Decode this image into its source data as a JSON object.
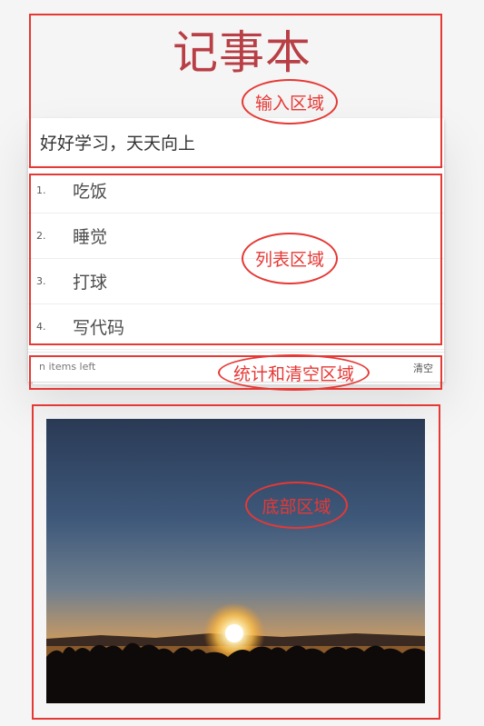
{
  "app": {
    "title": "记事本"
  },
  "input": {
    "value": "好好学习，天天向上"
  },
  "todos": [
    {
      "num": "1.",
      "text": "吃饭"
    },
    {
      "num": "2.",
      "text": "睡觉"
    },
    {
      "num": "3.",
      "text": "打球"
    },
    {
      "num": "4.",
      "text": "写代码"
    }
  ],
  "footer": {
    "count_text": "n items left",
    "clear_label": "清空"
  },
  "annotations": {
    "input_area": "输入区域",
    "list_area": "列表区域",
    "stats_area": "统计和清空区域",
    "bottom_area": "底部区域"
  },
  "colors": {
    "annotation": "#e53935",
    "title": "#b83f45",
    "background": "#f5f5f5"
  }
}
